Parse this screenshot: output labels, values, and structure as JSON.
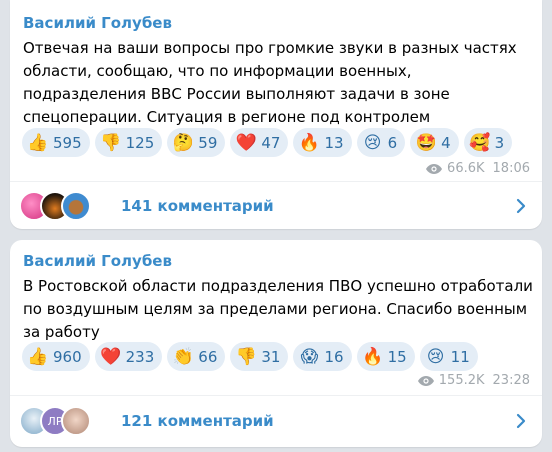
{
  "posts": [
    {
      "author": "Василий Голубев",
      "text": "Отвечая на ваши вопросы про громкие звуки в разных частях области, сообщаю, что по информации военных, подразделения ВВС России выполняют задачи в зоне спецоперации. Ситуация в регионе под контролем",
      "reactions": [
        {
          "emoji": "👍",
          "count": "595"
        },
        {
          "emoji": "👎",
          "count": "125"
        },
        {
          "emoji": "🤔",
          "count": "59"
        },
        {
          "emoji": "❤️",
          "count": "47"
        },
        {
          "emoji": "🔥",
          "count": "13"
        },
        {
          "emoji": "😢",
          "count": "6"
        },
        {
          "emoji": "🤩",
          "count": "4"
        },
        {
          "emoji": "🥰",
          "count": "3"
        }
      ],
      "views": "66.6K",
      "time": "18:06",
      "comments": "141 комментарий",
      "avatars": [
        {
          "color": "#e25aa0",
          "text": ""
        },
        {
          "color": "#3b2a1a",
          "text": ""
        },
        {
          "color": "#4a86c5",
          "text": ""
        }
      ]
    },
    {
      "author": "Василий Голубев",
      "text": "В Ростовской области подразделения ПВО успешно отработали по воздушным целям за пределами региона. Спасибо военным за работу",
      "reactions": [
        {
          "emoji": "👍",
          "count": "960"
        },
        {
          "emoji": "❤️",
          "count": "233"
        },
        {
          "emoji": "👏",
          "count": "66"
        },
        {
          "emoji": "👎",
          "count": "31"
        },
        {
          "emoji": "😱",
          "count": "16"
        },
        {
          "emoji": "🔥",
          "count": "15"
        },
        {
          "emoji": "😢",
          "count": "11"
        }
      ],
      "views": "155.2K",
      "time": "23:28",
      "comments": "121 комментарий",
      "avatars": [
        {
          "color": "#9fc0d8",
          "text": ""
        },
        {
          "color": "#8e7cc3",
          "text": "ЛР"
        },
        {
          "color": "#d9b9a8",
          "text": ""
        }
      ]
    }
  ]
}
